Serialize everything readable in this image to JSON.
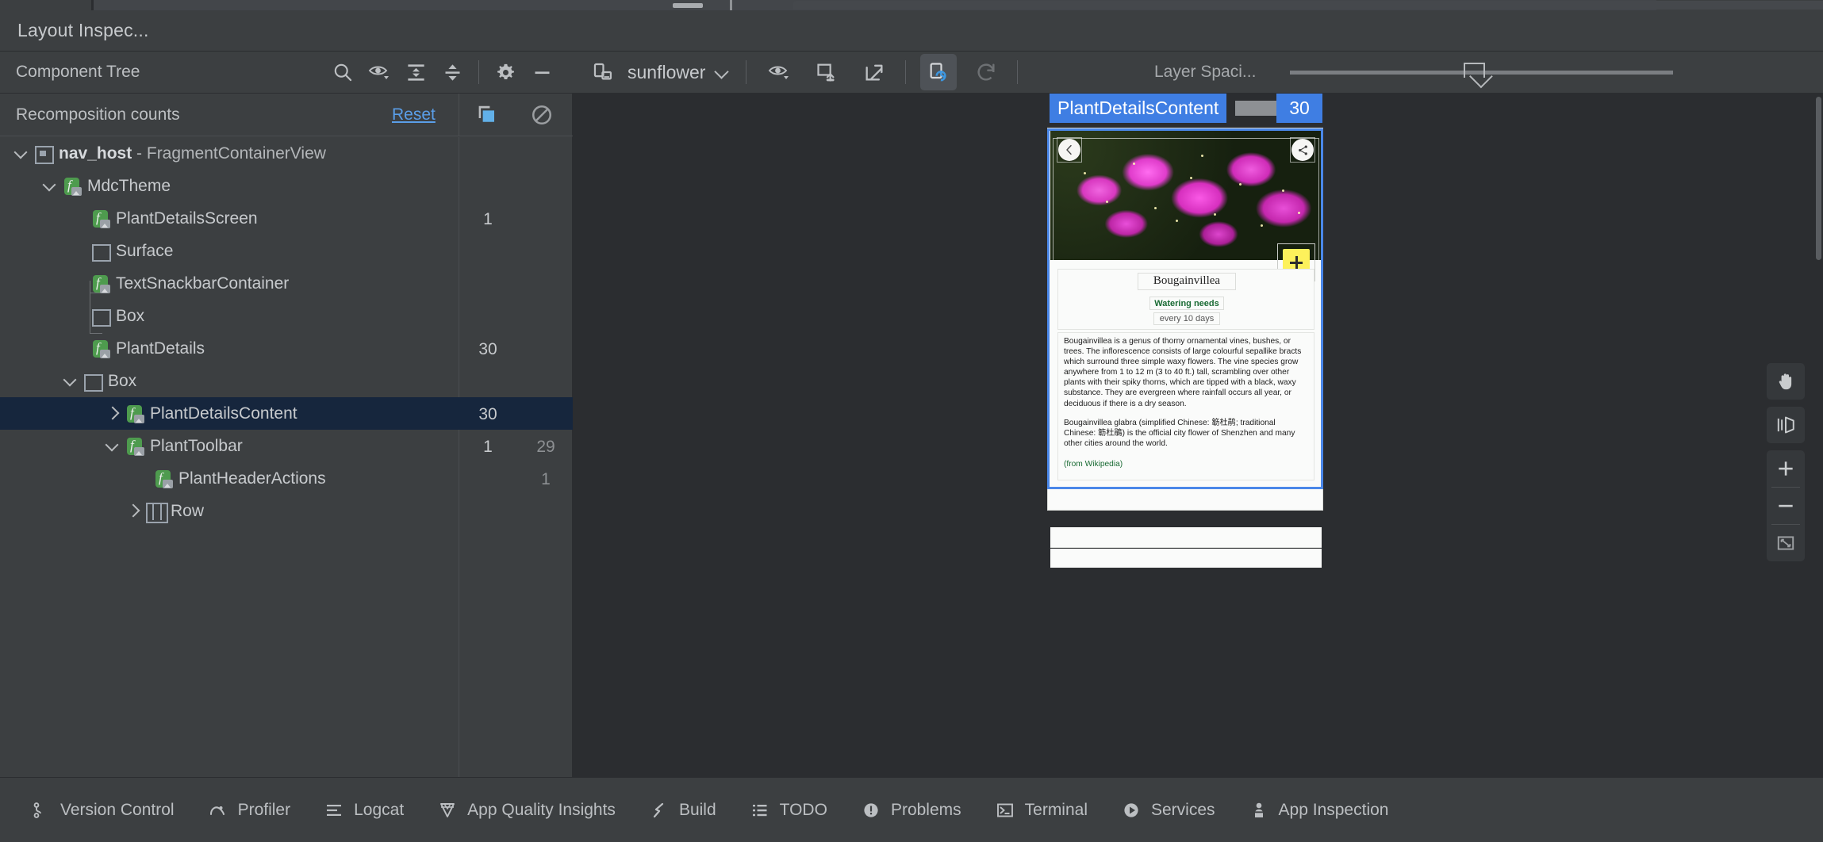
{
  "window": {
    "title": "Layout Inspec..."
  },
  "tree_toolbar": {
    "title": "Component Tree",
    "icons": [
      {
        "name": "search-icon",
        "label": "Search"
      },
      {
        "name": "eye-dropdown-icon",
        "label": "Filter visibility"
      },
      {
        "name": "expand-all-icon",
        "label": "Expand all"
      },
      {
        "name": "collapse-all-icon",
        "label": "Collapse all"
      },
      {
        "name": "gear-icon",
        "label": "Settings"
      },
      {
        "name": "minus-icon",
        "label": "Hide"
      }
    ]
  },
  "device_toolbar": {
    "device_name": "sunflower",
    "chevron": "chevron-down-icon",
    "icons": [
      {
        "name": "eye-dropdown-icon",
        "label": "View options"
      },
      {
        "name": "snapshot-icon",
        "label": "Save snapshot"
      },
      {
        "name": "export-icon",
        "label": "Open in new window"
      },
      {
        "name": "live-updates-icon",
        "label": "Live updates",
        "toggled": true
      },
      {
        "name": "refresh-icon",
        "label": "Refresh",
        "disabled": true
      }
    ]
  },
  "layer_spacing": {
    "label": "Layer Spaci...",
    "value": 45
  },
  "recomposition": {
    "title": "Recomposition counts",
    "reset_label": "Reset",
    "icons": [
      {
        "name": "highlight-recomposition-icon",
        "label": "Show recomposition highlights"
      },
      {
        "name": "reset-counts-icon",
        "label": "Stop counting"
      }
    ]
  },
  "component_tree": {
    "rows": [
      {
        "depth": 0,
        "toggle": "down",
        "icon": "view-icon",
        "label": "nav_host",
        "suffix": " - FragmentContainerView",
        "bold": true,
        "count": "",
        "skips": ""
      },
      {
        "depth": 1,
        "toggle": "down",
        "icon": "composable-icon",
        "label": "MdcTheme",
        "suffix": "",
        "bold": false,
        "count": "",
        "skips": ""
      },
      {
        "depth": 2,
        "toggle": "none",
        "icon": "composable-icon",
        "label": "PlantDetailsScreen",
        "suffix": "",
        "bold": false,
        "count": "1",
        "skips": ""
      },
      {
        "depth": 2,
        "toggle": "none",
        "icon": "box-icon",
        "label": "Surface",
        "suffix": "",
        "bold": false,
        "count": "",
        "skips": ""
      },
      {
        "depth": 2,
        "toggle": "none",
        "icon": "composable-icon",
        "label": "TextSnackbarContainer",
        "suffix": "",
        "bold": false,
        "count": "",
        "skips": ""
      },
      {
        "depth": 2,
        "toggle": "none",
        "icon": "box-icon",
        "label": "Box",
        "suffix": "",
        "bold": false,
        "count": "",
        "skips": ""
      },
      {
        "depth": 2,
        "toggle": "none",
        "icon": "composable-icon",
        "label": "PlantDetails",
        "suffix": "",
        "bold": false,
        "count": "30",
        "skips": ""
      },
      {
        "depth": 2,
        "toggle": "down",
        "icon": "box-icon",
        "label": "Box",
        "suffix": "",
        "bold": false,
        "count": "",
        "skips": ""
      },
      {
        "depth": 3,
        "toggle": "right",
        "icon": "composable-icon",
        "label": "PlantDetailsContent",
        "suffix": "",
        "bold": false,
        "count": "30",
        "skips": "",
        "selected": true
      },
      {
        "depth": 3,
        "toggle": "down",
        "icon": "composable-icon",
        "label": "PlantToolbar",
        "suffix": "",
        "bold": false,
        "count": "1",
        "skips": "29"
      },
      {
        "depth": 4,
        "toggle": "none",
        "icon": "composable-icon",
        "label": "PlantHeaderActions",
        "suffix": "",
        "bold": false,
        "count": "",
        "skips": "1"
      },
      {
        "depth": 4,
        "toggle": "right",
        "icon": "row-icon",
        "label": "Row",
        "suffix": "",
        "bold": false,
        "count": "",
        "skips": ""
      }
    ]
  },
  "preview": {
    "selection_label": "PlantDetailsContent",
    "selection_count": "30",
    "back_icon": "back-arrow-icon",
    "share_icon": "share-icon",
    "fab_icon": "plus-icon",
    "plant_name": "Bougainvillea",
    "watering_title": "Watering needs",
    "watering_value": "every 10 days",
    "description_p1": "Bougainvillea is a genus of thorny ornamental vines, bushes, or trees. The inflorescence consists of large colourful sepallike bracts which surround three simple waxy flowers. The vine species grow anywhere from 1 to 12 m (3 to 40 ft.) tall, scrambling over other plants with their spiky thorns, which are tipped with a black, waxy substance. They are evergreen where rainfall occurs all year, or deciduous if there is a dry season.",
    "description_p2": "Bougainvillea glabra (simplified Chinese: 簕杜鹃; traditional Chinese: 簕杜鵑) is the official city flower of Shenzhen and many other cities around the world.",
    "source": "(from Wikipedia)"
  },
  "canvas_tools": [
    {
      "name": "pan-tool-icon",
      "label": "Pan"
    },
    {
      "name": "rotate-3d-icon",
      "label": "Toggle 3D mode"
    },
    {
      "name": "zoom-in-icon",
      "label": "Zoom in"
    },
    {
      "name": "zoom-out-icon",
      "label": "Zoom out"
    },
    {
      "name": "zoom-to-fit-icon",
      "label": "Zoom to fit"
    }
  ],
  "statusbar": {
    "items": [
      {
        "icon": "version-control-icon",
        "label": "Version Control"
      },
      {
        "icon": "profiler-icon",
        "label": "Profiler"
      },
      {
        "icon": "logcat-icon",
        "label": "Logcat"
      },
      {
        "icon": "app-quality-insights-icon",
        "label": "App Quality Insights"
      },
      {
        "icon": "build-icon",
        "label": "Build"
      },
      {
        "icon": "todo-icon",
        "label": "TODO"
      },
      {
        "icon": "problems-icon",
        "label": "Problems"
      },
      {
        "icon": "terminal-icon",
        "label": "Terminal"
      },
      {
        "icon": "services-icon",
        "label": "Services"
      },
      {
        "icon": "app-inspection-icon",
        "label": "App Inspection"
      }
    ]
  },
  "colors": {
    "background": "#2b2d30",
    "panel": "#3c3f41",
    "accent_blue": "#3f7ee3",
    "link_blue": "#5a9ee8",
    "selection": "#16263d",
    "composable_green": "#4e9b4e",
    "fab_yellow": "#fdf15b"
  }
}
